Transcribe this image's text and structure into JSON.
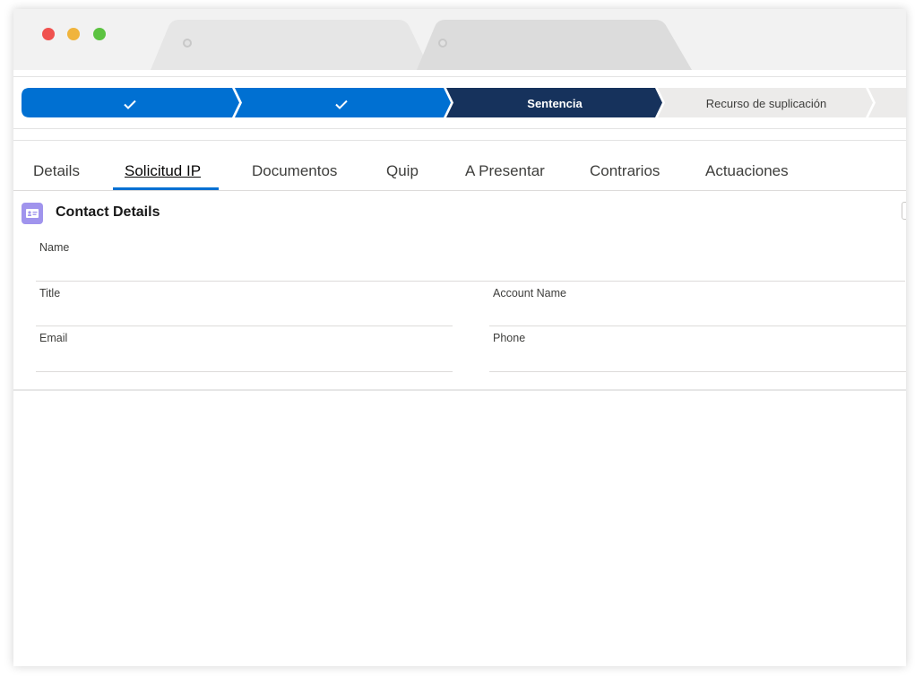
{
  "window": {
    "traffic_lights": {
      "close": "#f0524f",
      "minimize": "#f0b43c",
      "zoom": "#5cc341"
    },
    "tabs": [
      {
        "title": "",
        "close_icon": "close-icon"
      },
      {
        "title": "",
        "close_icon": "close-icon"
      }
    ]
  },
  "path": {
    "stages": [
      {
        "label": "",
        "status": "complete",
        "icon": "check-icon",
        "color": "#0070d2"
      },
      {
        "label": "",
        "status": "complete",
        "icon": "check-icon",
        "color": "#0070d2"
      },
      {
        "label": "Sentencia",
        "status": "current",
        "color": "#16325c"
      },
      {
        "label": "Recurso de suplicación",
        "status": "incomplete",
        "color": "#ecebea"
      },
      {
        "label": "",
        "status": "incomplete",
        "color": "#ecebea"
      }
    ]
  },
  "tabs": {
    "items": [
      {
        "label": "Details",
        "active": false
      },
      {
        "label": "Solicitud IP",
        "active": true
      },
      {
        "label": "Documentos",
        "active": false
      },
      {
        "label": "Quip",
        "active": false
      },
      {
        "label": "A Presentar",
        "active": false
      },
      {
        "label": "Contrarios",
        "active": false
      },
      {
        "label": "Actuaciones",
        "active": false
      }
    ],
    "accent_color": "#0070d2"
  },
  "card": {
    "icon": "contact-card-icon",
    "title": "Contact Details",
    "fields": {
      "name": {
        "label": "Name",
        "value": ""
      },
      "title": {
        "label": "Title",
        "value": ""
      },
      "account_name": {
        "label": "Account Name",
        "value": ""
      },
      "email": {
        "label": "Email",
        "value": ""
      },
      "phone": {
        "label": "Phone",
        "value": ""
      }
    }
  }
}
